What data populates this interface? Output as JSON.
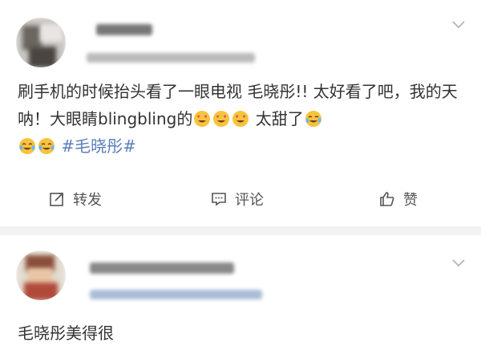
{
  "post": {
    "text_part1": "刷手机的时候抬头看了一眼电视  毛晓彤!!  太好看了吧，我的天呐！大眼睛blingbling的",
    "text_part2": "太甜了",
    "topic": "#毛晓彤#",
    "emoji_heart_eyes": "heart-eyes-emoji",
    "emoji_tears": "tears-of-joy-emoji"
  },
  "actions": {
    "repost_label": "转发",
    "comment_label": "评论",
    "like_label": "赞"
  },
  "comment": {
    "text": "毛晓彤美得很"
  },
  "colors": {
    "topic": "#5b7eb8",
    "background": "#f2f2f2",
    "card": "#ffffff"
  }
}
